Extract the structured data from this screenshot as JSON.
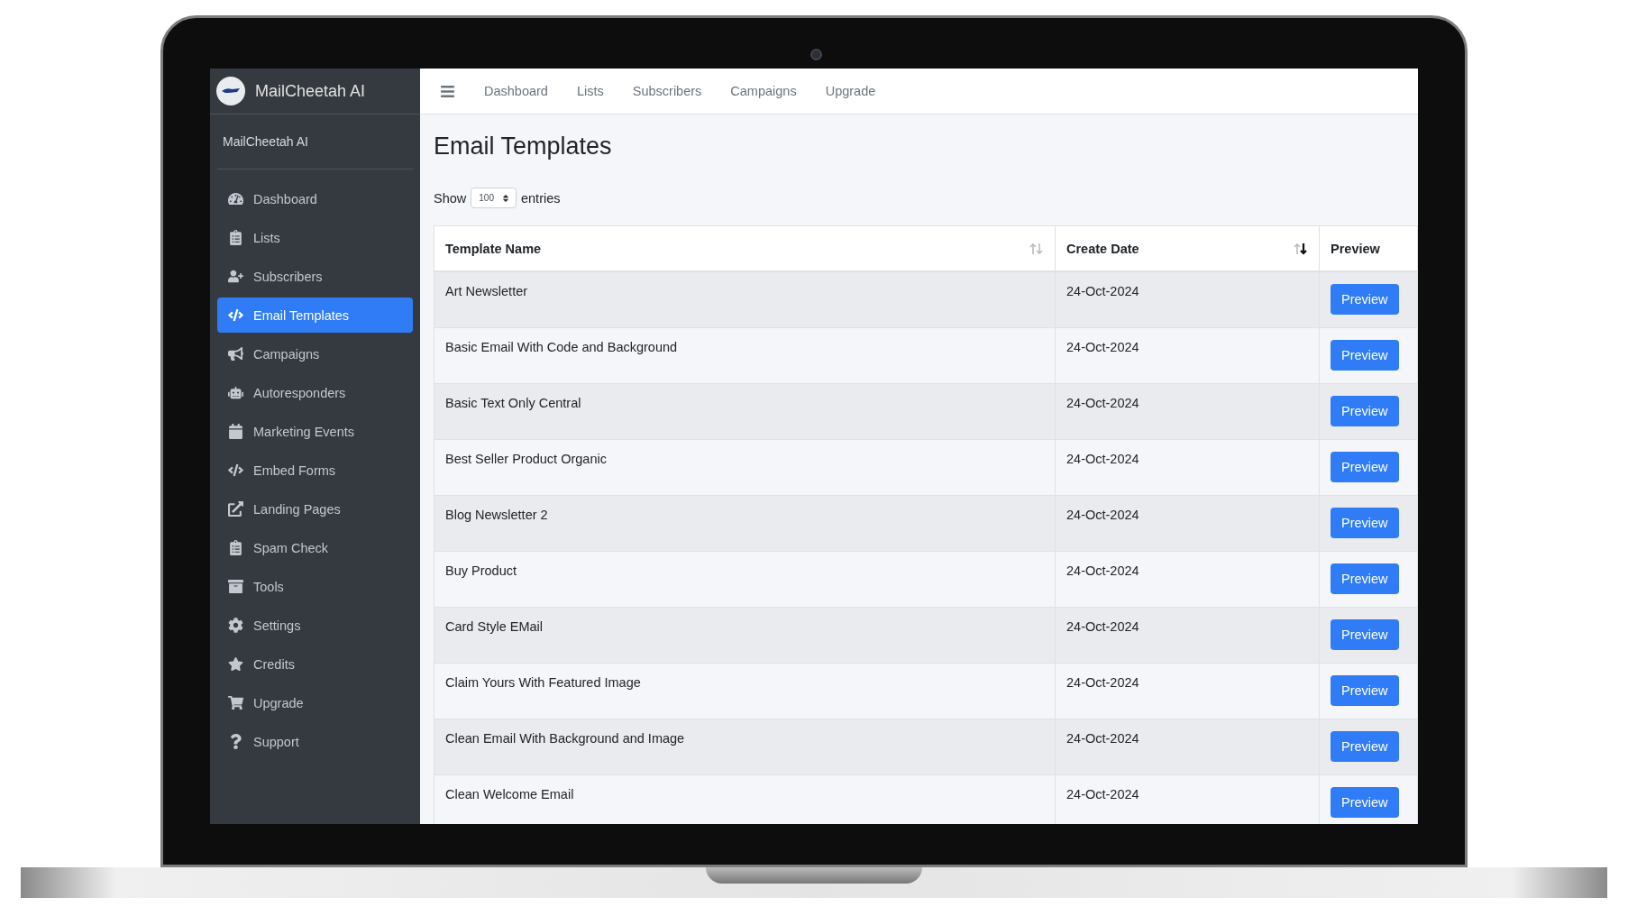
{
  "sidebar": {
    "brand": "MailCheetah AI",
    "user": "MailCheetah AI",
    "items": [
      {
        "label": "Dashboard",
        "selected": false
      },
      {
        "label": "Lists",
        "selected": false
      },
      {
        "label": "Subscribers",
        "selected": false
      },
      {
        "label": "Email Templates",
        "selected": true
      },
      {
        "label": "Campaigns",
        "selected": false
      },
      {
        "label": "Autoresponders",
        "selected": false
      },
      {
        "label": "Marketing Events",
        "selected": false
      },
      {
        "label": "Embed Forms",
        "selected": false
      },
      {
        "label": "Landing Pages",
        "selected": false
      },
      {
        "label": "Spam Check",
        "selected": false
      },
      {
        "label": "Tools",
        "selected": false
      },
      {
        "label": "Settings",
        "selected": false
      },
      {
        "label": "Credits",
        "selected": false
      },
      {
        "label": "Upgrade",
        "selected": false
      },
      {
        "label": "Support",
        "selected": false
      }
    ]
  },
  "topbar": {
    "links": [
      "Dashboard",
      "Lists",
      "Subscribers",
      "Campaigns",
      "Upgrade"
    ]
  },
  "page": {
    "title": "Email Templates",
    "show_label": "Show",
    "page_size": "100",
    "entries_label": "entries"
  },
  "table": {
    "columns": [
      {
        "label": "Template Name",
        "sortable": true,
        "sorted": false
      },
      {
        "label": "Create Date",
        "sortable": true,
        "sorted": true
      },
      {
        "label": "Preview",
        "sortable": false,
        "sorted": false
      }
    ],
    "rows": [
      {
        "name": "Art Newsletter",
        "date": "24-Oct-2024",
        "action": "Preview"
      },
      {
        "name": "Basic Email With Code and Background",
        "date": "24-Oct-2024",
        "action": "Preview"
      },
      {
        "name": "Basic Text Only Central",
        "date": "24-Oct-2024",
        "action": "Preview"
      },
      {
        "name": "Best Seller Product Organic",
        "date": "24-Oct-2024",
        "action": "Preview"
      },
      {
        "name": "Blog Newsletter 2",
        "date": "24-Oct-2024",
        "action": "Preview"
      },
      {
        "name": "Buy Product",
        "date": "24-Oct-2024",
        "action": "Preview"
      },
      {
        "name": "Card Style EMail",
        "date": "24-Oct-2024",
        "action": "Preview"
      },
      {
        "name": "Claim Yours With Featured Image",
        "date": "24-Oct-2024",
        "action": "Preview"
      },
      {
        "name": "Clean Email With Background and Image",
        "date": "24-Oct-2024",
        "action": "Preview"
      },
      {
        "name": "Clean Welcome Email",
        "date": "24-Oct-2024",
        "action": "Preview"
      }
    ]
  }
}
